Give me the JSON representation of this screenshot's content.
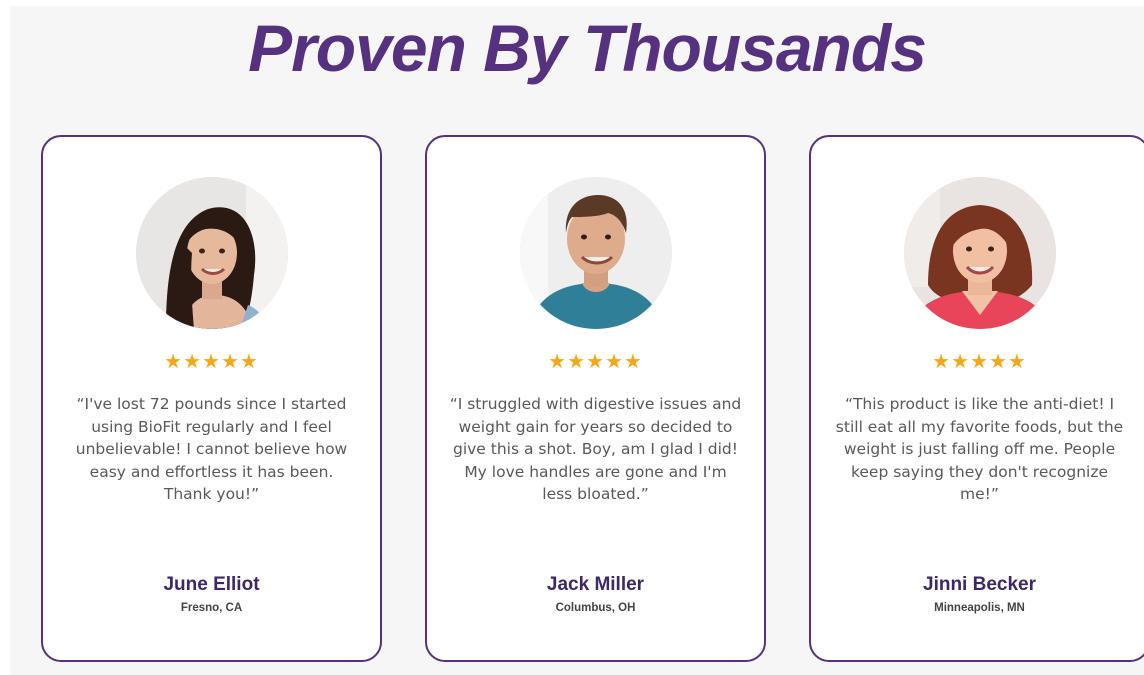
{
  "section": {
    "heading": "Proven By Thousands"
  },
  "colors": {
    "brand_purple": "#55317f",
    "star_gold": "#f5a817",
    "section_bg": "#f6f6f7"
  },
  "testimonials": [
    {
      "avatar_icon": "woman-photo",
      "rating": 5,
      "stars": "★★★★★",
      "quote": "“I've lost 72 pounds since I started using BioFit regularly and I feel unbelievable! I cannot believe how easy and effortless it has been. Thank you!”",
      "name": "June Elliot",
      "location": "Fresno, CA"
    },
    {
      "avatar_icon": "man-photo",
      "rating": 5,
      "stars": "★★★★★",
      "quote": "“I struggled with digestive issues and weight gain for years so decided to give this a shot. Boy, am I glad I did! My love handles are gone and I'm less bloated.”",
      "name": "Jack Miller",
      "location": "Columbus, OH"
    },
    {
      "avatar_icon": "woman-photo",
      "rating": 5,
      "stars": "★★★★★",
      "quote": "“This product is like the anti-diet! I still eat all my favorite foods, but the weight is just falling off me. People keep saying they don't recognize me!”",
      "name": "Jinni Becker",
      "location": "Minneapolis, MN"
    }
  ]
}
